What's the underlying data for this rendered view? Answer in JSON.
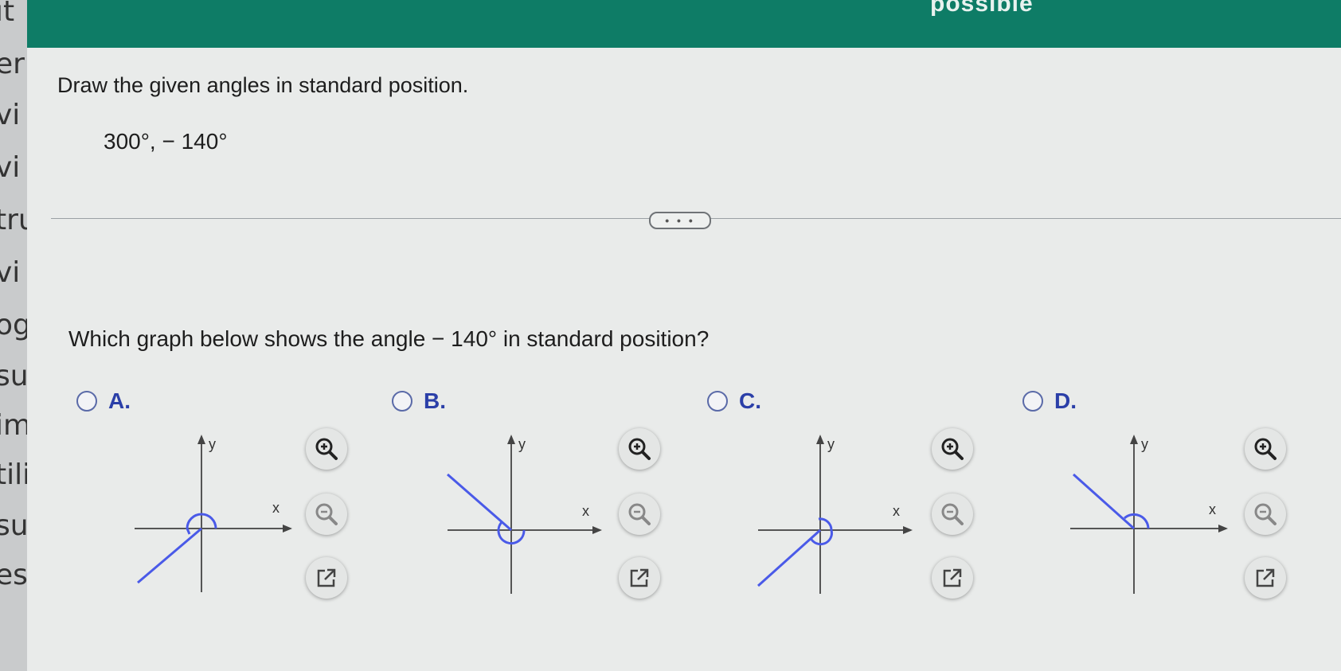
{
  "header": {
    "partial_text": "possible"
  },
  "left_strip": {
    "fragments": [
      "ıt",
      "er",
      "vi",
      "vi",
      "tru",
      "vi",
      "ogı",
      "su",
      "iml",
      "tiliz",
      "sur",
      "ese"
    ]
  },
  "question": {
    "instruction": "Draw the given angles in standard position.",
    "angles": "300°, − 140°",
    "more_button": "• • •",
    "prompt": "Which graph below shows the angle  − 140°  in standard position?"
  },
  "options": [
    {
      "letter": "A.",
      "x_label": "x",
      "y_label": "y",
      "terminal_direction": "down-left",
      "arc_quadrant": "upper"
    },
    {
      "letter": "B.",
      "x_label": "x",
      "y_label": "y",
      "terminal_direction": "up-left",
      "arc_quadrant": "lower"
    },
    {
      "letter": "C.",
      "x_label": "x",
      "y_label": "y",
      "terminal_direction": "down-left",
      "arc_quadrant": "right"
    },
    {
      "letter": "D.",
      "x_label": "x",
      "y_label": "y",
      "terminal_direction": "up-left",
      "arc_quadrant": "upper"
    }
  ],
  "tools": [
    "zoom-in-icon",
    "zoom-out-icon",
    "open-external-icon"
  ],
  "colors": {
    "header": "#0e7c66",
    "accent": "#2b3fa8",
    "angle_line": "#4a5ae8"
  }
}
